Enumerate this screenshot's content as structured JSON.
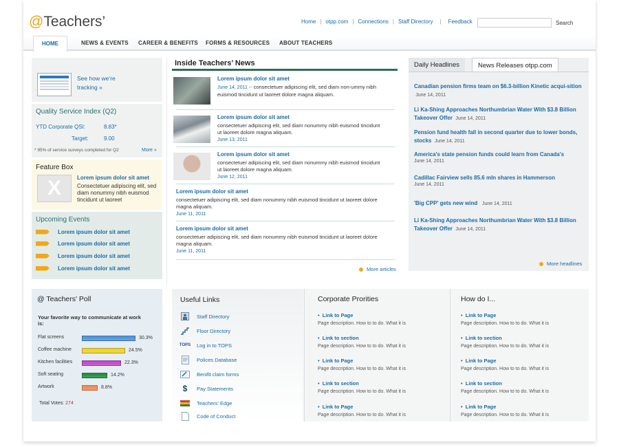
{
  "header": {
    "logo_at": "@",
    "logo_text": "Teachers’",
    "top_links": [
      "Home",
      "otpp.com",
      "Connections",
      "Staff Directory",
      "Feedback"
    ],
    "search_button": "Search"
  },
  "nav": {
    "items": [
      "HOME",
      "NEWS & EVENTS",
      "CAREER & BENEFITS",
      "FORMS & RESOURCES",
      "ABOUT TEACHERS"
    ]
  },
  "tracking": {
    "text": "See how we’re tracking  »"
  },
  "qsi": {
    "title": "Quality Service Index (Q2)",
    "ytd_label": "YTD Corporate QSI:",
    "ytd_value": "8.83*",
    "target_label": "Target:",
    "target_value": "9.00",
    "footnote": "* 95% of service surveys completed for Q2",
    "more": "More »"
  },
  "feature": {
    "title": "Feature Box",
    "headline": "Lorem ipsum dolor sit amet",
    "body": "Consectetuer adipiscing elit, sed diam nonummy nibh euismod tincidunt ut laoreet"
  },
  "events": {
    "title": "Upcoming Events",
    "items": [
      "Lorem ipsum dolor sit amet",
      "Lorem ipsum dolor sit amet",
      "Lorem ipsum dolor sit amet",
      "Lorem ipsum dolor sit amet"
    ]
  },
  "inside_news": {
    "title": "Inside Teachers’ News",
    "items": [
      {
        "title": "Lorem ipsum dolor sit amet",
        "date": "June 14, 2011 --",
        "body": "consectetuer adipiscing elit, sed diam non-ummy nibh euismod tincidunt ut laoreet dolore magna aliquam."
      },
      {
        "title": "Lorem ipsum dolor sit amet",
        "date": "June 13, 2011",
        "body": "consectetuer adipiscing elit, sed diam nonummy nibh euismod tincidunt ut laoreet dolore magna aliquam."
      },
      {
        "title": "Lorem ipsum dolor sit amet",
        "date": "June 12, 2011",
        "body": "consectetuer adipiscing elit, sed diam nonummy nibh euismod tincidunt ut laoreet dolore magna aliquam."
      },
      {
        "title": "Lorem ipsum dolor sit amet",
        "date": "June 11, 2011",
        "body": "consectetuer adipiscing elit, sed diam nonummy nibh euismod tincidunt ut laoreet dolore magna aliquam."
      },
      {
        "title": "Lorem ipsum dolor sit amet",
        "date": "June 11, 2011",
        "body": "consectetuer adipiscing elit, sed diam nonummy nibh euismod tincidunt ut laoreet dolore magna aliquam."
      }
    ],
    "more": "More articles"
  },
  "headlines": {
    "tab1": "Daily Headlines",
    "tab2": "News Releases otpp.com",
    "items": [
      {
        "title": "Canadian pension firms team on $6.3-billion Kinetic acqui-sition",
        "date": "June 14, 2011"
      },
      {
        "title": "Li Ka-Shing Approaches Northumbrian Water With $3.8 Billion Takeover Offer",
        "date": "June 14, 2011"
      },
      {
        "title": "Pension fund health fall in second quarter due to lower bonds, stocks",
        "date": "June 14, 2011"
      },
      {
        "title": "America's state pension funds could learn from Canada's",
        "date": "June 14, 2011"
      },
      {
        "title": "Cadillac Fairview sells 85.6 mln shares in Hammerson",
        "date": "June 14, 2011"
      },
      {
        "title": "'Big CPP' gets new wind",
        "date": "June 14, 2011"
      },
      {
        "title": "Li Ka-Shing Approaches Northumbrian Water With $3.8 Billion Takeover Offer",
        "date": "June 14, 2011"
      }
    ],
    "more": "More headlines"
  },
  "poll": {
    "title": "@ Teachers' Poll",
    "question": "Your favorite way to communicate at work is:",
    "options": [
      {
        "label": "Flat screens",
        "pct": "30.3%",
        "value": 30.3,
        "color": "#4a90d9"
      },
      {
        "label": "Coffee machine",
        "pct": "24.5%",
        "value": 24.5,
        "color": "#f2d21a"
      },
      {
        "label": "Kitchen facilities",
        "pct": "22.3%",
        "value": 22.3,
        "color": "#c040c8"
      },
      {
        "label": "Soft seating",
        "pct": "14.2%",
        "value": 14.2,
        "color": "#1c8a3a"
      },
      {
        "label": "Artwork",
        "pct": "8.8%",
        "value": 8.8,
        "color": "#f08a50"
      }
    ],
    "total_label": "Total Votes:",
    "total_value": "274"
  },
  "useful": {
    "title": "Useful Links",
    "items": [
      {
        "label": "Staff Directory",
        "icon": "person-icon"
      },
      {
        "label": "Floor Directory",
        "icon": "stairs-icon"
      },
      {
        "label": "Log in to TOPS",
        "icon": "tops-icon"
      },
      {
        "label": "Polices Database",
        "icon": "document-icon"
      },
      {
        "label": "Benifit claim forms",
        "icon": "form-icon"
      },
      {
        "label": "Pay Statements",
        "icon": "dollar-icon"
      },
      {
        "label": "Teachers' Edge",
        "icon": "book-icon"
      },
      {
        "label": "Code of Conduct",
        "icon": "page-icon"
      }
    ]
  },
  "corporate": {
    "title": "Corporate Prorities",
    "items": [
      {
        "title": "Link to  Page",
        "desc": "Page description. How to to do. What it is"
      },
      {
        "title": "Link to section",
        "desc": "Page description. How to to do. What it is"
      },
      {
        "title": "Link to  Page",
        "desc": "Page description. How to to do. What it is"
      },
      {
        "title": "Link to section",
        "desc": "Page description. How to to do. What it is"
      },
      {
        "title": "Link to  Page",
        "desc": "Page description. How to to do. What it is"
      }
    ]
  },
  "howdo": {
    "title": "How do I...",
    "items": [
      {
        "title": "Link to  Page",
        "desc": "Page description. How to to do. What it is"
      },
      {
        "title": "Link to section",
        "desc": "Page description. How to to do. What it is"
      },
      {
        "title": "Link to  Page",
        "desc": "Page description. How to to do. What it is"
      },
      {
        "title": "Link to section",
        "desc": "Page description. How to to do. What it is"
      },
      {
        "title": "Link to  Page",
        "desc": "Page description. How to to do. What it is"
      }
    ]
  }
}
